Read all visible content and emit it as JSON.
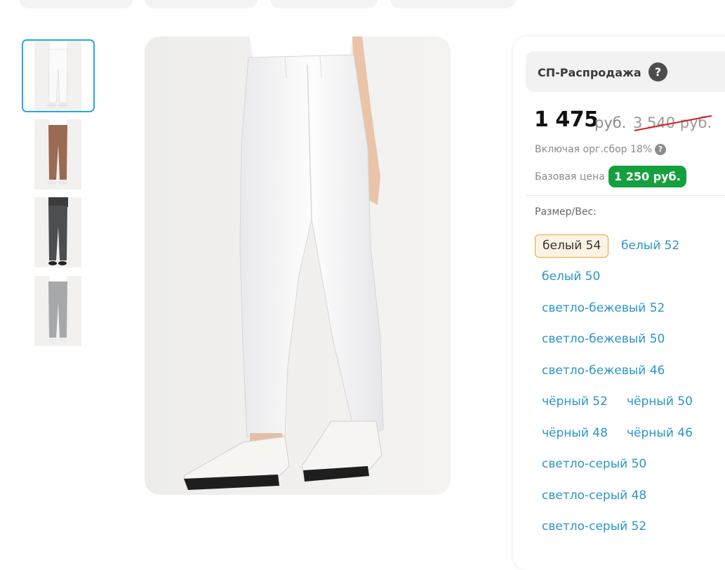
{
  "promo": {
    "title": "СП-Распродажа",
    "help_icon": "?"
  },
  "price": {
    "current": "1 475",
    "currency": "руб.",
    "old": "3 540 руб.",
    "fee_text": "Включая орг.сбор 18%",
    "fee_help": "?",
    "base_label": "Базовая цена",
    "base_value": "1 250 руб."
  },
  "size": {
    "label": "Размер/Вес:",
    "options": [
      "белый 54",
      "белый 52",
      "белый 50",
      "светло-бежевый 52",
      "светло-бежевый 50",
      "светло-бежевый 46",
      "чёрный 52",
      "чёрный 50",
      "чёрный 48",
      "чёрный 46",
      "светло-серый 50",
      "светло-серый 48",
      "светло-серый 52"
    ],
    "selected": "белый 54"
  },
  "gallery": {
    "thumbnails": [
      "white-pants-photo",
      "brown-pants-photo",
      "dark-grey-pants-photo",
      "light-grey-pants-photo"
    ],
    "active_index": 0
  },
  "colors": {
    "accent": "#2a96c7",
    "active_border": "#2aa7da",
    "badge_green": "#15a03f",
    "strike_red": "#cc2222",
    "selected_bg": "#fdf3e3",
    "selected_border": "#e9a33b"
  }
}
